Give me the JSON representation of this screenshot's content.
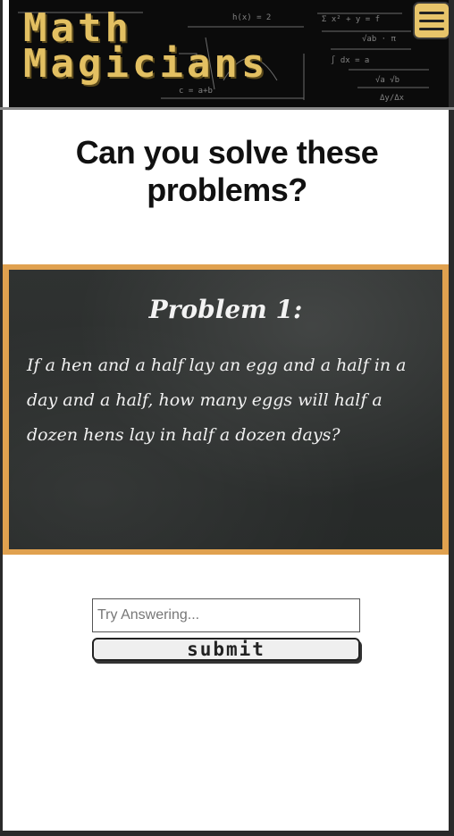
{
  "header": {
    "logo_line1": "Math",
    "logo_line2": "Magicians",
    "menu_icon": "hamburger-menu-icon"
  },
  "main": {
    "title": "Can you solve these problems?"
  },
  "problem": {
    "heading": "Problem 1:",
    "text": "If a hen and a half lay an egg and a half in a day and a half, how many eggs will half a dozen hens lay in half a dozen days?"
  },
  "form": {
    "input_placeholder": "Try Answering...",
    "submit_label": "submit"
  },
  "colors": {
    "accent": "#e3c062",
    "frame": "#e0a14f",
    "board": "#2c2f2e"
  }
}
